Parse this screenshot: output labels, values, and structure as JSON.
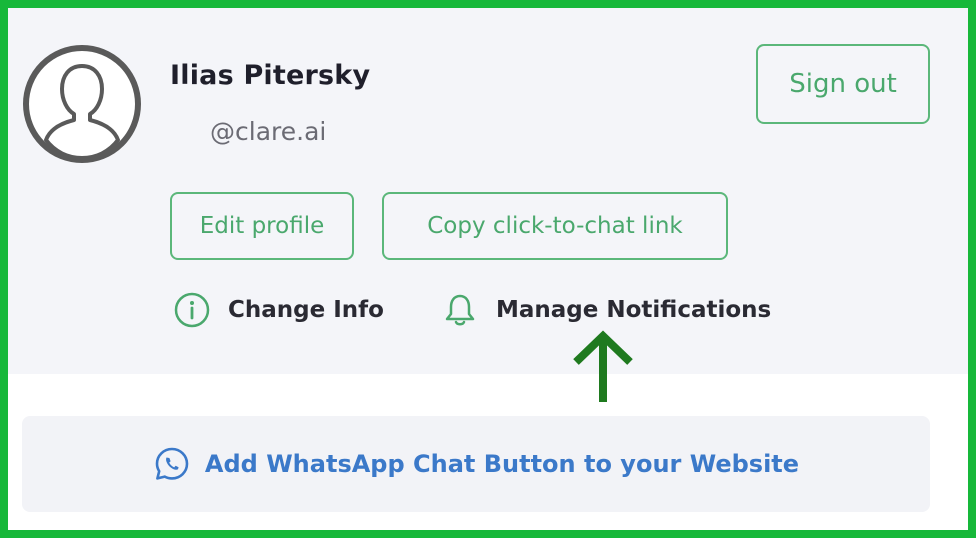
{
  "profile": {
    "name": "Ilias Pitersky",
    "handle": "@clare.ai",
    "avatar_icon": "user-silhouette-icon"
  },
  "buttons": {
    "sign_out": "Sign out",
    "edit_profile": "Edit profile",
    "copy_link": "Copy click-to-chat link"
  },
  "links": {
    "change_info": {
      "label": "Change Info",
      "icon": "info-circle-icon"
    },
    "manage_notifications": {
      "label": "Manage Notifications",
      "icon": "bell-icon"
    }
  },
  "banner": {
    "label": "Add WhatsApp Chat Button to your Website",
    "icon": "whatsapp-icon"
  },
  "colors": {
    "frame": "#17b83a",
    "accent_green": "#4aa86d",
    "banner_blue": "#3b79c9",
    "arrow": "#1f7a1f"
  }
}
